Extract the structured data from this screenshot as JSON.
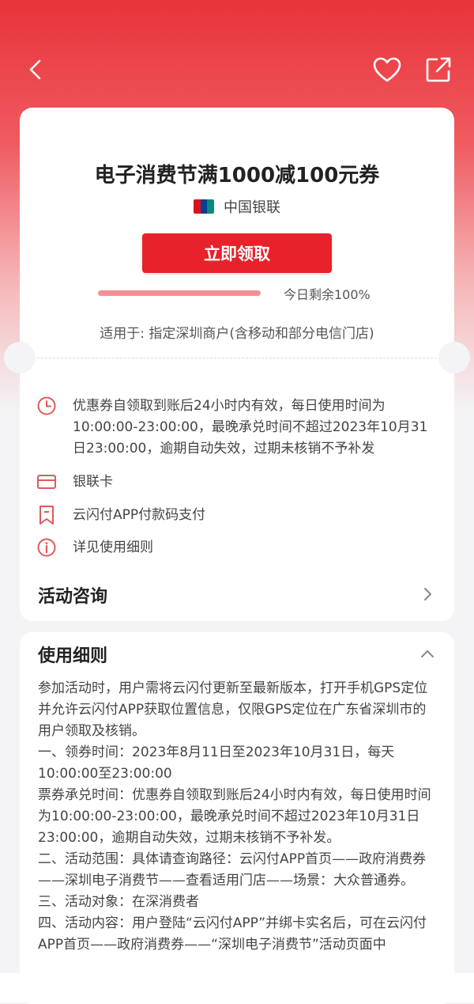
{
  "colors": {
    "accent": "#e8222b",
    "progress": "#f58f93"
  },
  "topbar": {
    "back_icon": "chevron-left-icon",
    "favorite_icon": "heart-icon",
    "share_icon": "share-icon"
  },
  "coupon": {
    "title": "电子消费节满1000减100元券",
    "issuer": "中国银联",
    "claim_label": "立即领取",
    "remaining_text": "今日剩余100%",
    "remaining_fraction": 1.0,
    "applies_to": "适用于: 指定深圳商户(含移动和部分电信门店)"
  },
  "info": [
    {
      "icon": "clock-icon",
      "text": "优惠券自领取到账后24小时内有效，每日使用时间为10:00:00-23:00:00，最晚承兑时间不超过2023年10月31日23:00:00，逾期自动失效，过期未核销不予补发"
    },
    {
      "icon": "card-icon",
      "text": "银联卡"
    },
    {
      "icon": "bookmark-icon",
      "text": "云闪付APP付款码支付"
    },
    {
      "icon": "info-icon",
      "text": "详见使用细则"
    }
  ],
  "consult": {
    "label": "活动咨询"
  },
  "rules": {
    "title": "使用细则",
    "paragraphs": [
      "参加活动时，用户需将云闪付更新至最新版本，打开手机GPS定位并允许云闪付APP获取位置信息，仅限GPS定位在广东省深圳市的用户领取及核销。",
      "一、领券时间：2023年8月11日至2023年10月31日，每天10:00:00至23:00:00",
      "票券承兑时间：优惠券自领取到账后24小时内有效，每日使用时间为10:00:00-23:00:00，最晚承兑时间不超过2023年10月31日23:00:00，逾期自动失效，过期未核销不予补发。",
      "二、活动范围：具体请查询路径：云闪付APP首页——政府消费券——深圳电子消费节——查看适用门店——场景：大众普通券。",
      "三、活动对象：在深消费者",
      "四、活动内容：用户登陆“云闪付APP”并绑卡实名后，可在云闪付APP首页——政府消费券——“深圳电子消费节”活动页面中"
    ]
  }
}
